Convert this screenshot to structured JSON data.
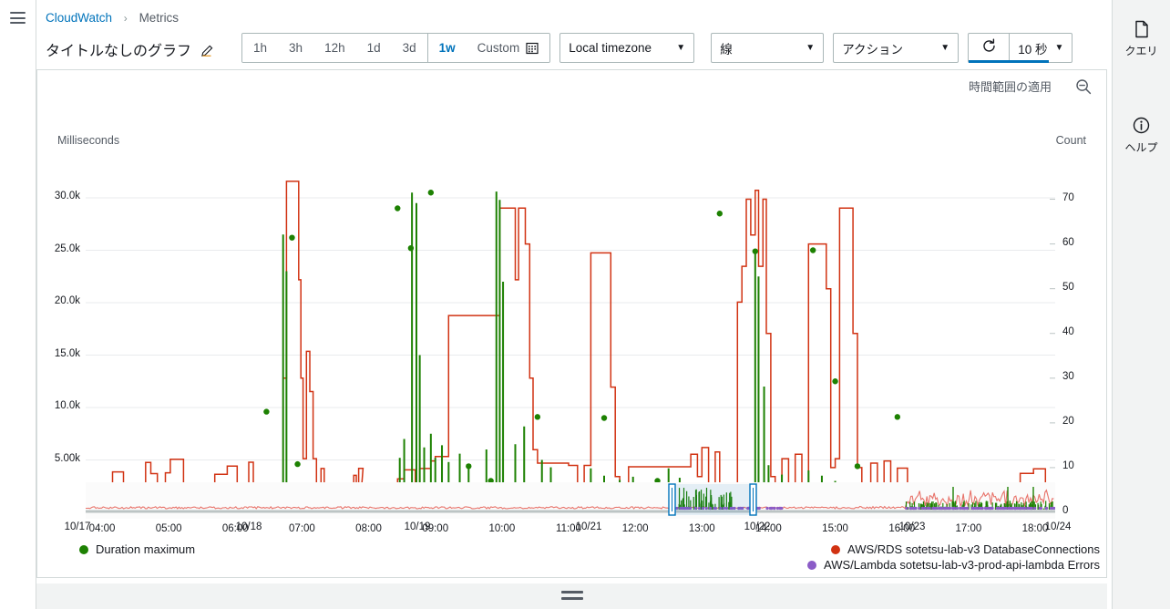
{
  "breadcrumb": {
    "root": "CloudWatch",
    "separator": "›",
    "current": "Metrics"
  },
  "graph": {
    "title": "タイトルなしのグラフ",
    "edit_icon": "pencil-icon"
  },
  "toolbar": {
    "ranges": [
      {
        "label": "1h",
        "active": false
      },
      {
        "label": "3h",
        "active": false
      },
      {
        "label": "12h",
        "active": false
      },
      {
        "label": "1d",
        "active": false
      },
      {
        "label": "3d",
        "active": false
      },
      {
        "label": "1w",
        "active": true
      }
    ],
    "custom_label": "Custom",
    "custom_icon": "calendar-icon",
    "timezone_value": "Local timezone",
    "chart_type_value": "線",
    "actions_label": "アクション",
    "refresh_icon": "refresh-icon",
    "refresh_interval": "10 秒",
    "caret": "▼",
    "accent_color": "#0073bb"
  },
  "card": {
    "apply_range_label": "時間範囲の適用",
    "zoom_out_icon": "zoom-out-icon"
  },
  "right_rail": [
    {
      "icon": "query-document-icon",
      "label": "クエリ"
    },
    {
      "icon": "help-info-icon",
      "label": "ヘルプ"
    }
  ],
  "left_rail": {
    "menu_icon": "hamburger-menu-icon"
  },
  "bottom": {
    "resize_icon": "resize-handle-icon"
  },
  "chart_data": {
    "type": "line",
    "title": "タイトルなしのグラフ",
    "xlabel": "",
    "ylabel": "Milliseconds",
    "y2label": "Count",
    "grid": true,
    "legend_position": "bottom",
    "y_left_ticks": [
      "5.00k",
      "10.0k",
      "15.0k",
      "20.0k",
      "25.0k",
      "30.0k"
    ],
    "y_left_values": [
      5000,
      10000,
      15000,
      20000,
      25000,
      30000
    ],
    "ylim": [
      0,
      32000
    ],
    "y_right_ticks": [
      "0",
      "10",
      "20",
      "30",
      "40",
      "50",
      "60",
      "70"
    ],
    "y_right_values": [
      0,
      10,
      20,
      30,
      40,
      50,
      60,
      70
    ],
    "y2lim": [
      0,
      75
    ],
    "x_ticks": [
      "04:00",
      "05:00",
      "06:00",
      "07:00",
      "08:00",
      "09:00",
      "10:00",
      "11:00",
      "12:00",
      "13:00",
      "14:00",
      "15:00",
      "16:00",
      "17:00",
      "18:00"
    ],
    "overview_ticks": [
      "10/17",
      "10/18",
      "10/19",
      "10/21",
      "10/22",
      "10/23",
      "10/24"
    ],
    "brush_selection": {
      "start": "10/21",
      "end": "10/21 midday",
      "color": "#e8f4fb",
      "border": "#0073bb"
    },
    "series": [
      {
        "name": "Duration maximum",
        "color": "#1d8102",
        "axis": "left",
        "style": "line-with-markers",
        "peak_values": [
          30500,
          29000,
          28800,
          26000,
          25000,
          25000,
          24000,
          10000,
          9600,
          5000,
          4500,
          3000,
          2500,
          2000
        ],
        "notable_points": [
          {
            "x": "06:45",
            "y": 26000
          },
          {
            "x": "08:40",
            "y": 29000
          },
          {
            "x": "08:55",
            "y": 25000
          },
          {
            "x": "09:55",
            "y": 30500
          },
          {
            "x": "10:00",
            "y": 29800
          },
          {
            "x": "11:20",
            "y": 25000
          },
          {
            "x": "13:00",
            "y": 28500
          },
          {
            "x": "13:40",
            "y": 25000
          },
          {
            "x": "06:10",
            "y": 9600
          },
          {
            "x": "11:15",
            "y": 9000
          },
          {
            "x": "15:25",
            "y": 9000
          },
          {
            "x": "14:10",
            "y": 12500
          }
        ]
      },
      {
        "name": "AWS/RDS sotetsu-lab-v3 DatabaseConnections",
        "color": "#d13212",
        "axis": "right",
        "style": "step-line",
        "baseline": 0,
        "plateau_values": [
          70,
          68,
          65,
          60,
          58,
          45,
          44,
          20,
          12,
          10,
          8,
          5,
          3,
          1
        ],
        "notable_plateaus": [
          {
            "from": "06:45",
            "to": "06:55",
            "value": 74
          },
          {
            "from": "09:00",
            "to": "09:55",
            "value": 44
          },
          {
            "from": "09:55",
            "to": "10:25",
            "value": 68
          },
          {
            "from": "11:10",
            "to": "11:25",
            "value": 58
          },
          {
            "from": "12:50",
            "to": "13:10",
            "value": 70
          },
          {
            "from": "13:55",
            "to": "14:05",
            "value": 68
          },
          {
            "from": "11:35",
            "to": "12:35",
            "value": 10
          },
          {
            "from": "14:30",
            "to": "18:30",
            "value": 2
          }
        ]
      },
      {
        "name": "AWS/Lambda sotetsu-lab-v3-prod-api-lambda Errors",
        "color": "#8b5cc7",
        "axis": "right",
        "style": "scatter-near-zero",
        "typical_value": 1,
        "max_value": 2
      }
    ]
  }
}
